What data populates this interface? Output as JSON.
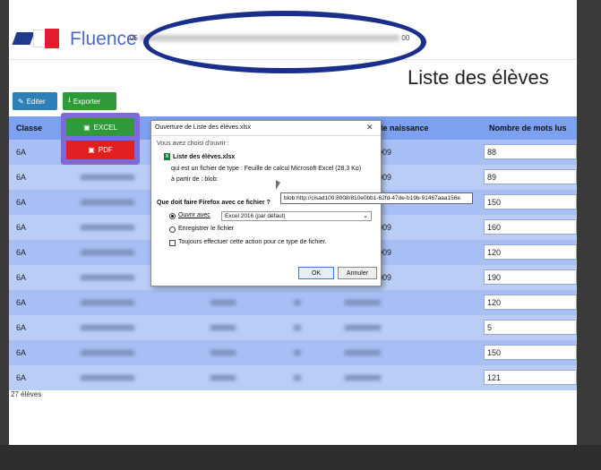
{
  "header": {
    "brand": "Fluence",
    "school_prefix": "05",
    "school_suffix": "00"
  },
  "page_title": "Liste des élèves",
  "toolbar": {
    "edit_label": "Editer",
    "export_label": "Exporter"
  },
  "export_menu": {
    "excel_label": "EXCEL",
    "pdf_label": "PDF"
  },
  "table": {
    "columns": [
      "Classe",
      "de naissance",
      "Nombre de mots lus"
    ],
    "rows": [
      {
        "classe": "6A",
        "year": "009",
        "mots": "88"
      },
      {
        "classe": "6A",
        "year": "009",
        "mots": "89"
      },
      {
        "classe": "6A",
        "year": "",
        "mots": "150"
      },
      {
        "classe": "6A",
        "year": "009",
        "mots": "160"
      },
      {
        "classe": "6A",
        "year": "009",
        "mots": "120"
      },
      {
        "classe": "6A",
        "year": "009",
        "mots": "190"
      },
      {
        "classe": "6A",
        "year": "",
        "mots": "120"
      },
      {
        "classe": "6A",
        "year": "",
        "mots": "5"
      },
      {
        "classe": "6A",
        "year": "",
        "mots": "150"
      },
      {
        "classe": "6A",
        "year": "",
        "mots": "121"
      }
    ]
  },
  "count_label": "27 élèves",
  "dialog": {
    "title": "Ouverture de Liste des élèves.xlsx",
    "intro": "Vous avez choisi d'ouvrir :",
    "filename": "Liste des élèves.xlsx",
    "filetype": "qui est un fichier de type : Feuille de calcul Microsoft Excel (28,3 Ko)",
    "source": "à partir de : blob:",
    "question": "Que doit faire Firefox avec ce fichier ?",
    "open_with_label": "Ouvrir avec",
    "open_with_value": "Excel 2016 (par défaut)",
    "save_label": "Enregistrer le fichier",
    "always_label": "Toujours effectuer cette action pour ce type de fichier.",
    "ok_label": "OK",
    "cancel_label": "Annuler",
    "tooltip": "blob:http://cisad100:8008/810e0bb1-62fd-47de-b19b-91467aaa156e"
  },
  "colors": {
    "brand_blue": "#4f68c4",
    "header_row": "#7da0f0",
    "annotation_oval": "#1a2f8a",
    "export_menu": "#7b6ad8"
  }
}
